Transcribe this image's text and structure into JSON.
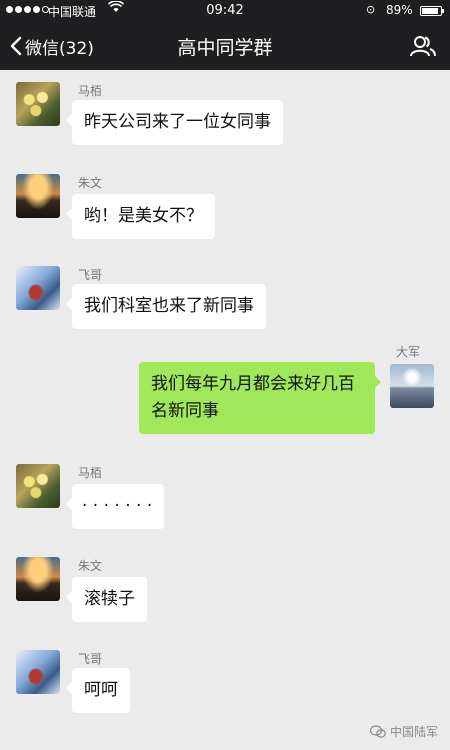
{
  "status_bar": {
    "carrier": "中国联通",
    "time": "09:42",
    "battery_text": "89%",
    "battery_level": 0.89,
    "signal_bars": 4
  },
  "nav": {
    "back_label": "微信(32)",
    "title": "高中同学群"
  },
  "messages": [
    {
      "sender": "马栢",
      "text": "昨天公司来了一位女同事",
      "side": "left",
      "avatar": "flowers"
    },
    {
      "sender": "朱文",
      "text": "哟！是美女不？",
      "side": "left",
      "avatar": "sunset"
    },
    {
      "sender": "飞哥",
      "text": "我们科室也来了新同事",
      "side": "left",
      "avatar": "person"
    },
    {
      "sender": "大军",
      "text": "我们每年九月都会来好几百名新同事",
      "side": "right",
      "avatar": "sea"
    },
    {
      "sender": "马栢",
      "text": "· · · · · · ·",
      "side": "left",
      "avatar": "flowers"
    },
    {
      "sender": "朱文",
      "text": "滚犊子",
      "side": "left",
      "avatar": "sunset"
    },
    {
      "sender": "飞哥",
      "text": "呵呵",
      "side": "left",
      "avatar": "person"
    }
  ],
  "watermark": "中国陆军",
  "colors": {
    "header_bg": "#1f1f22",
    "chat_bg": "#ebebeb",
    "bubble_self": "#a0e75a",
    "bubble_other": "#ffffff"
  }
}
